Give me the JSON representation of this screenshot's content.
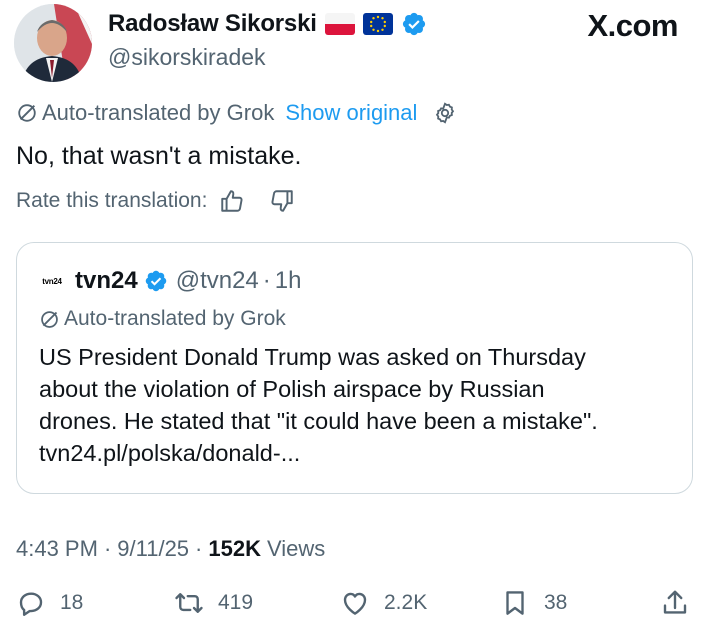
{
  "author": {
    "display_name": "Radosław Sikorski",
    "handle": "@sikorskiradek",
    "flags": [
      "flag-poland",
      "flag-eu"
    ],
    "verified_color": "#1d9bf0"
  },
  "site": {
    "logo_text": "X.com"
  },
  "translation": {
    "label": "Auto-translated by Grok",
    "show_original": "Show original",
    "rate_label": "Rate this translation:"
  },
  "tweet": {
    "text": "No, that wasn't a mistake."
  },
  "quote": {
    "avatar_text": "tvn24",
    "name": "tvn24",
    "handle": "@tvn24",
    "separator": "·",
    "time": "1h",
    "translation_label": "Auto-translated by Grok",
    "body_lines": [
      "US President Donald Trump was asked on Thursday",
      "about the violation of Polish airspace by Russian",
      "drones. He stated that \"it could have been a mistake\".",
      "tvn24.pl/polska/donald-..."
    ]
  },
  "meta": {
    "time": "4:43 PM",
    "separator": "·",
    "date": "9/11/25",
    "separator2": "·",
    "views_count": "152K",
    "views_label": "Views"
  },
  "actions": {
    "replies": "18",
    "reposts": "419",
    "likes": "2.2K",
    "bookmarks": "38"
  },
  "colors": {
    "accent": "#1d9bf0",
    "secondary_text": "#536471",
    "border": "#cfd9de"
  }
}
